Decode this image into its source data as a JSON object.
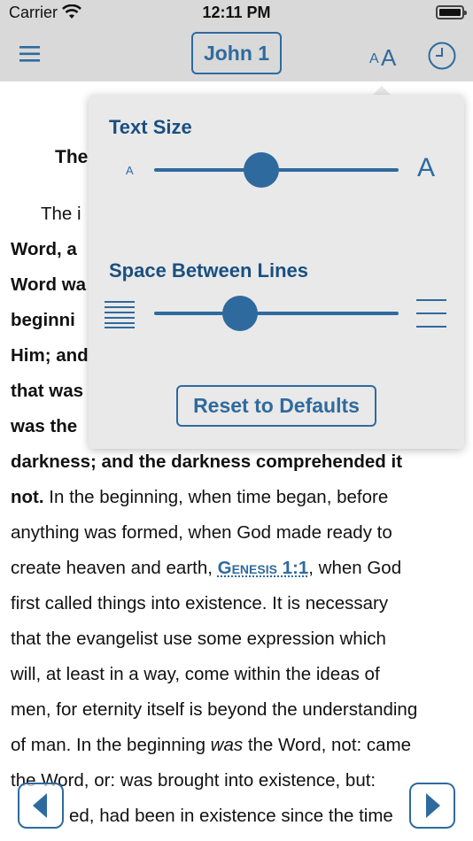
{
  "status_bar": {
    "carrier": "Carrier",
    "time": "12:11 PM"
  },
  "nav": {
    "book_label": "John 1",
    "text_size_small": "A",
    "text_size_large": "A"
  },
  "content": {
    "heading": "The",
    "paragraph": [
      {
        "text": "The i",
        "bold": false
      },
      {
        "text": "Word, a",
        "bold": true
      },
      {
        "text": "Word wa",
        "bold": true
      },
      {
        "text": "beginni",
        "bold": true
      },
      {
        "text": "Him; and",
        "bold": true
      },
      {
        "text": "that was",
        "bold": true
      },
      {
        "text": "was the",
        "bold": true
      }
    ],
    "line_darkness": "darkness; and the darkness comprehended it",
    "line_not": "not.",
    "line_not_rest": " In the beginning, when time began, before",
    "line_anything": "anything was formed, when God made ready to",
    "line_create_pre": "create heaven and earth, ",
    "link_genesis": "Genesis 1:1",
    "line_create_post": ", when God",
    "line_first": "first called things into existence. It is necessary",
    "line_that": "that the evangelist use some expression which",
    "line_will": "will, at least in a way, come within the ideas of",
    "line_men": "men, for eternity itself is beyond the understanding",
    "line_of_pre": "of man. In the beginning ",
    "line_of_was": "was",
    "line_of_post": " the Word, not: came",
    "line_the": "the Word, or: was brought into existence, but:",
    "line_last": "ed, had been in existence since the time"
  },
  "popover": {
    "text_size_title": "Text Size",
    "small_a": "A",
    "large_a": "A",
    "text_size_level": 0.44,
    "line_spacing_title": "Space Between Lines",
    "line_spacing_level": 0.35,
    "reset_label": "Reset to Defaults"
  },
  "colors": {
    "accent": "#2f6a9e",
    "popover_bg": "#e9e9e9",
    "bar_bg": "#d9d9d9"
  },
  "icons": [
    "wifi-icon",
    "battery-icon",
    "hamburger-menu-icon",
    "text-size-icon",
    "history-clock-icon",
    "compact-lines-icon",
    "spaced-lines-icon",
    "chevron-left-icon",
    "chevron-right-icon"
  ]
}
